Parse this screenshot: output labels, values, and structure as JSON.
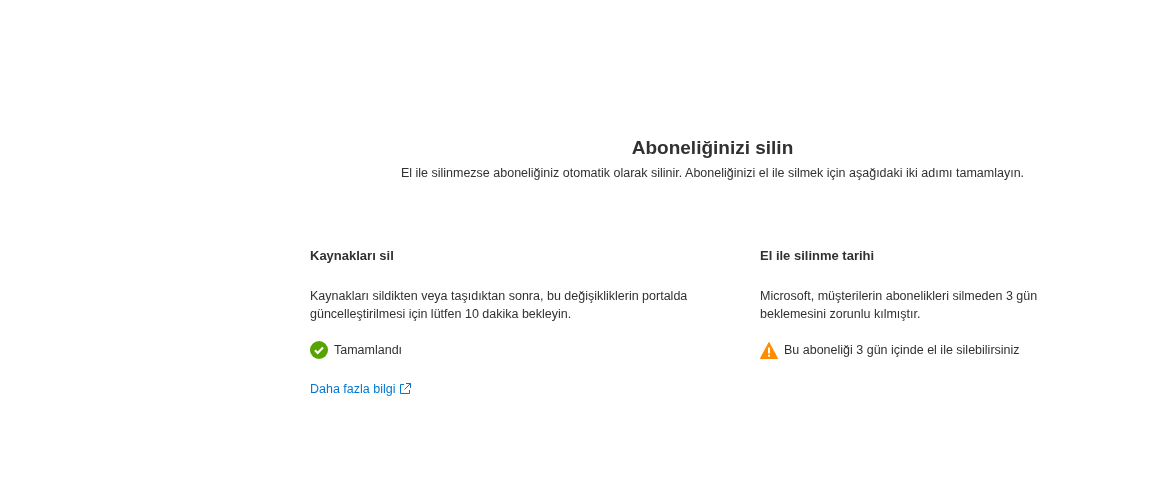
{
  "title": "Aboneliğinizi silin",
  "subtitle": "El ile silinmezse aboneliğiniz otomatik olarak silinir. Aboneliğinizi el ile silmek için aşağıdaki iki adımı tamamlayın.",
  "steps": [
    {
      "heading": "Kaynakları sil",
      "description": "Kaynakları sildikten veya taşıdıktan sonra, bu değişikliklerin portalda güncelleştirilmesi için lütfen 10 dakika bekleyin.",
      "status": {
        "kind": "success",
        "text": "Tamamlandı"
      },
      "link": "Daha fazla bilgi"
    },
    {
      "heading": "El ile silinme tarihi",
      "description": "Microsoft, müşterilerin abonelikleri silmeden 3 gün beklemesini zorunlu kılmıştır.",
      "status": {
        "kind": "warning",
        "text": "Bu aboneliği 3 gün içinde el ile silebilirsiniz"
      }
    }
  ]
}
